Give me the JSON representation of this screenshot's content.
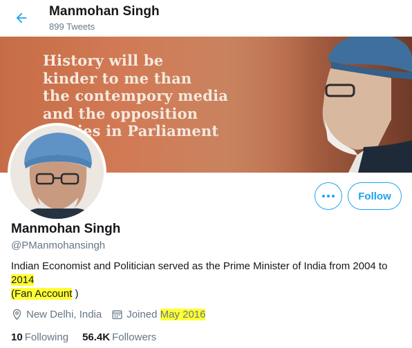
{
  "header": {
    "title": "Manmohan Singh",
    "tweet_count": "899 Tweets"
  },
  "banner": {
    "quote": "History will be\nkinder to me than\nthe contempory media\nand the opposition\nparties in Parliament"
  },
  "actions": {
    "follow_label": "Follow"
  },
  "profile": {
    "name": "Manmohan Singh",
    "handle": "@PManmohansingh",
    "bio_line1": "Indian Economist and Politician served as the Prime Minister of India from 2004 to",
    "bio_year": "2014",
    "bio_paren_open": "(",
    "bio_fan": "Fan Account",
    "bio_paren_close": " )",
    "location": "New Delhi, India",
    "joined_prefix": "Joined ",
    "joined_date": "May 2016"
  },
  "stats": {
    "following_count": "10",
    "following_label": "Following",
    "followers_count": "56.4K",
    "followers_label": "Followers"
  },
  "colors": {
    "accent": "#1da1f2",
    "highlight": "#ffff33",
    "muted": "#657786"
  }
}
